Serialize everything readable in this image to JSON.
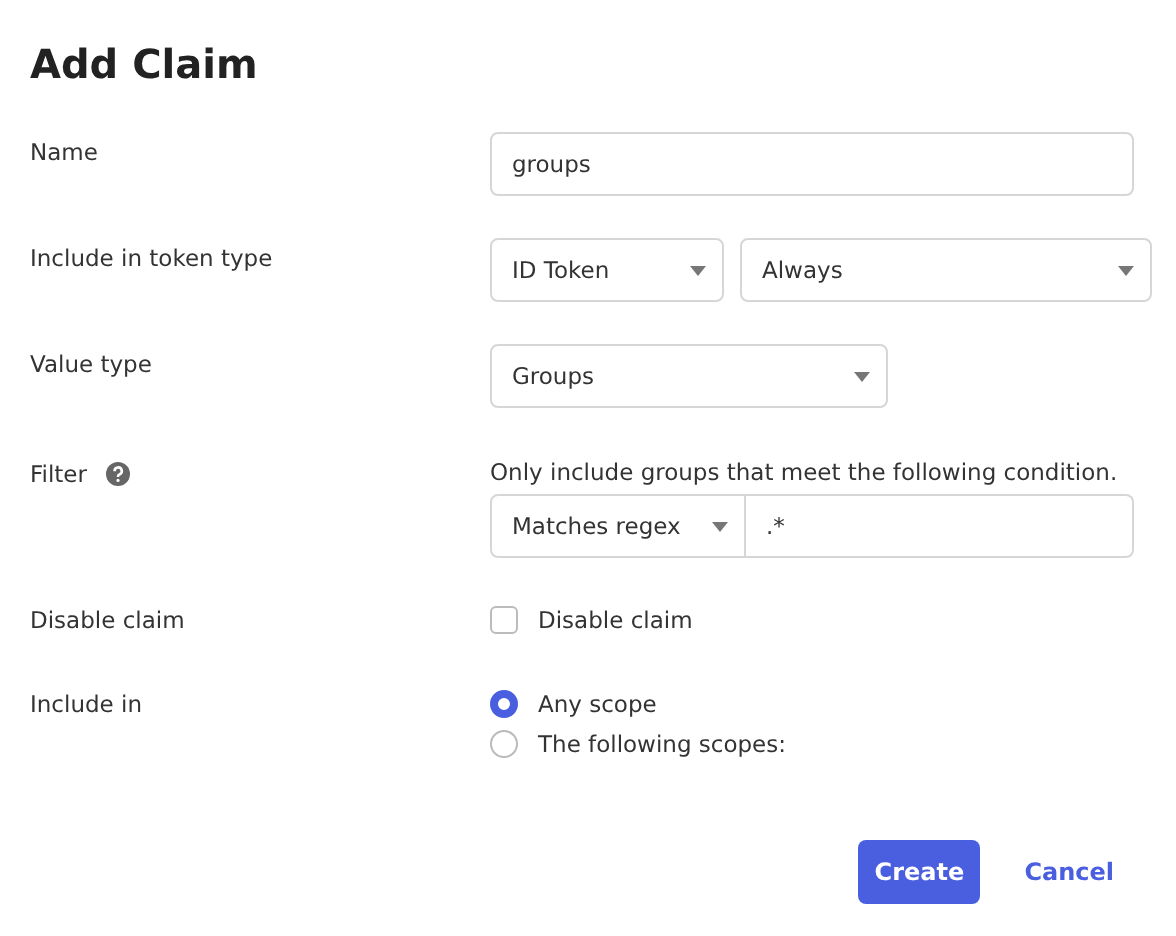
{
  "title": "Add Claim",
  "name": {
    "label": "Name",
    "value": "groups"
  },
  "token_type": {
    "label": "Include in token type",
    "token": "ID Token",
    "when": "Always"
  },
  "value_type": {
    "label": "Value type",
    "value": "Groups"
  },
  "filter": {
    "label": "Filter",
    "hint": "Only include groups that meet the following condition.",
    "operator": "Matches regex",
    "value": ".*"
  },
  "disable_claim": {
    "label": "Disable claim",
    "checkbox_label": "Disable claim",
    "checked": false
  },
  "include_in": {
    "label": "Include in",
    "options": [
      {
        "label": "Any scope",
        "selected": true
      },
      {
        "label": "The following scopes:",
        "selected": false
      }
    ]
  },
  "buttons": {
    "primary": "Create",
    "secondary": "Cancel"
  }
}
